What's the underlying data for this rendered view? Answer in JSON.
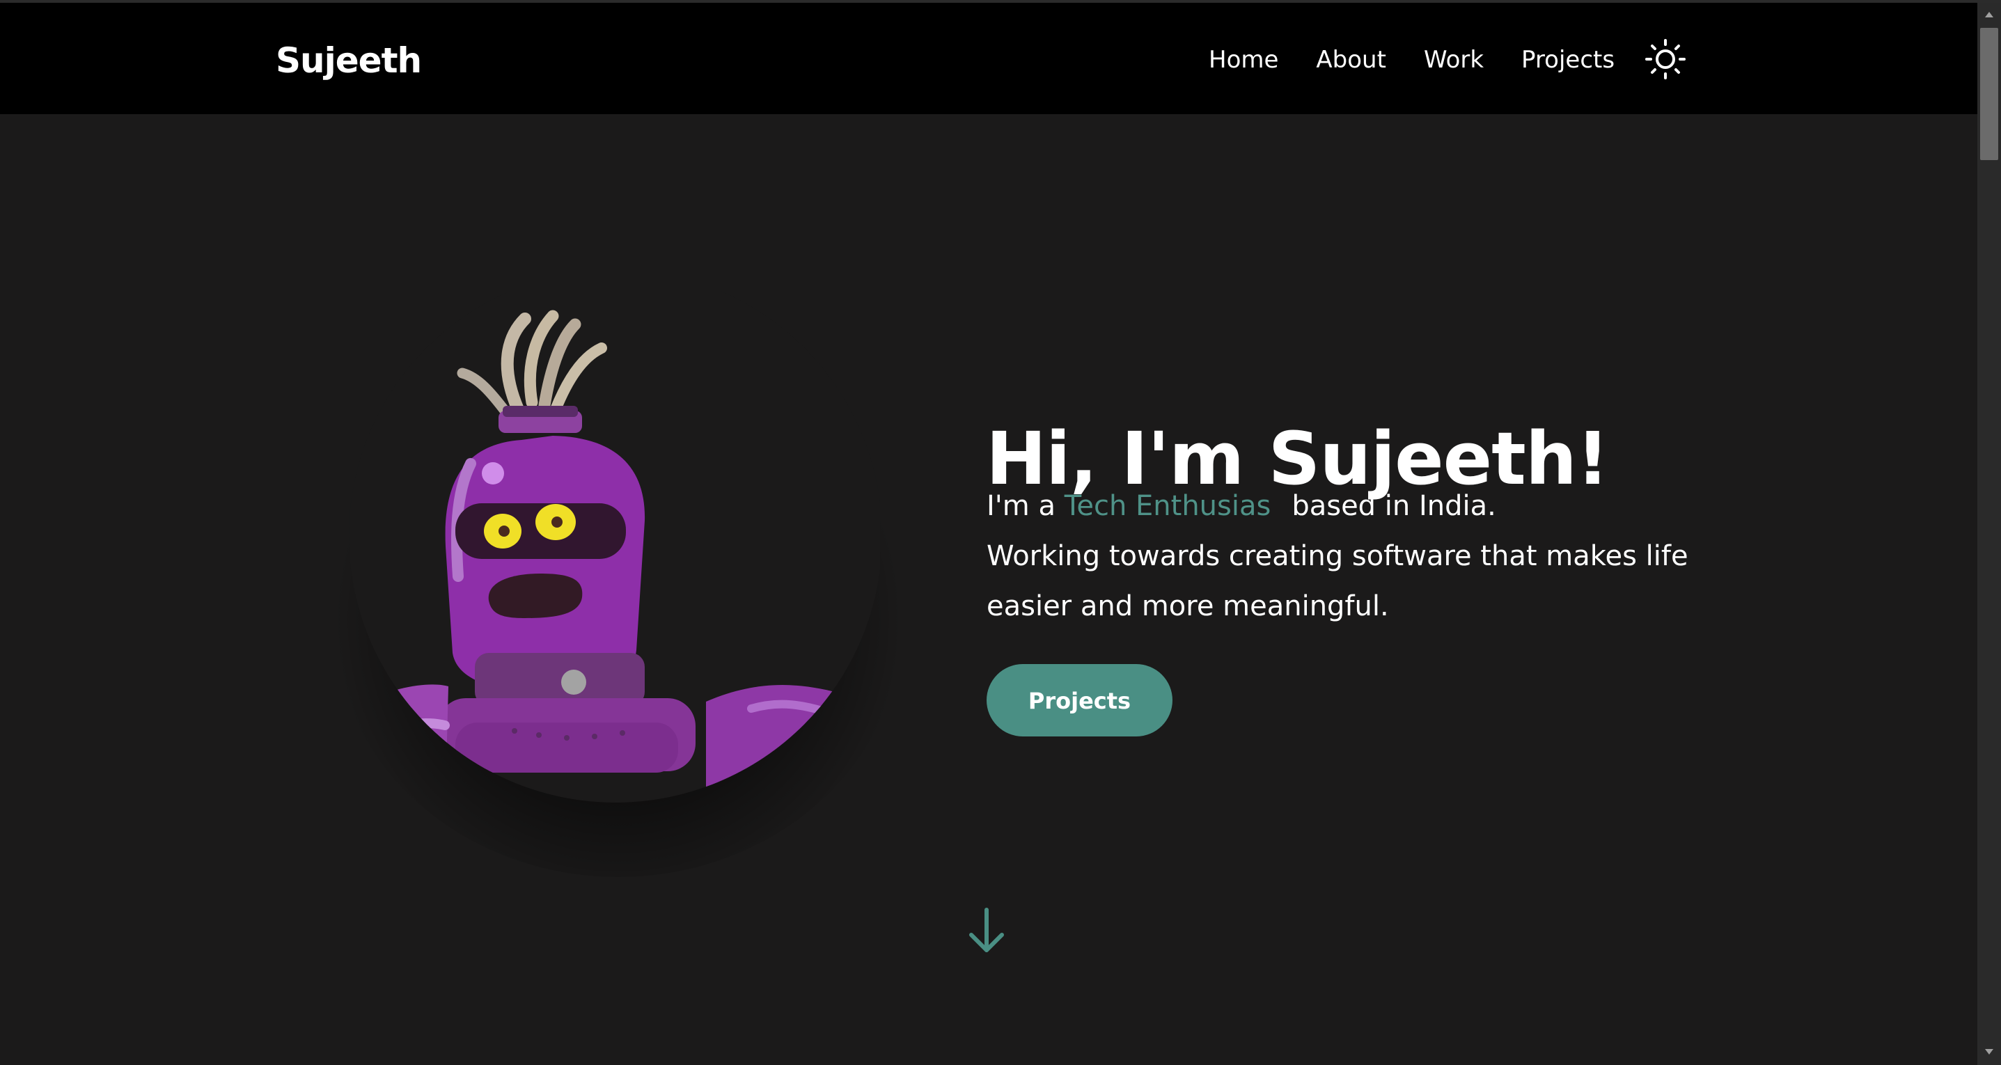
{
  "header": {
    "brand": "Sujeeth",
    "nav": [
      "Home",
      "About",
      "Work",
      "Projects"
    ]
  },
  "hero": {
    "title": "Hi, I'm Sujeeth!",
    "intro_prefix": "I'm a ",
    "highlight": "Tech Enthusias",
    "intro_suffix": "based in India.",
    "description": "Working towards creating software that makes life easier and more meaningful.",
    "cta_label": "Projects"
  },
  "colors": {
    "background": "#1b1a1a",
    "navbar": "#000000",
    "accent": "#4a8f84",
    "text": "#ffffff"
  },
  "icons": {
    "theme_toggle": "sun-icon",
    "scroll_down": "arrow-down-icon",
    "avatar": "robot-avatar"
  }
}
